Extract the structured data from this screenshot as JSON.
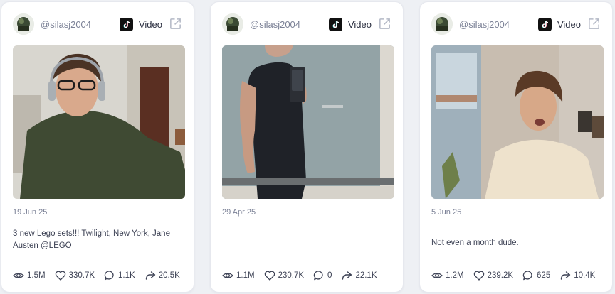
{
  "posts": [
    {
      "username": "@silasj2004",
      "platform": "Video",
      "date": "19 Jun 25",
      "caption": "3 new Lego sets!!! Twilight, New York, Jane Austen @LEGO",
      "stats": {
        "views": "1.5M",
        "likes": "330.7K",
        "comments": "1.1K",
        "shares": "20.5K"
      }
    },
    {
      "username": "@silasj2004",
      "platform": "Video",
      "date": "29 Apr 25",
      "caption": "",
      "stats": {
        "views": "1.1M",
        "likes": "230.7K",
        "comments": "0",
        "shares": "22.1K"
      }
    },
    {
      "username": "@silasj2004",
      "platform": "Video",
      "date": "5 Jun 25",
      "caption": "Not even a month dude.",
      "stats": {
        "views": "1.2M",
        "likes": "239.2K",
        "comments": "625",
        "shares": "10.4K"
      }
    }
  ],
  "icons": {
    "avatar": "avatar-icon",
    "platform": "tiktok-icon",
    "external": "external-link-icon",
    "views": "eye-icon",
    "likes": "heart-icon",
    "comments": "comment-icon",
    "shares": "share-icon"
  },
  "colors": {
    "text_muted": "#7b8196",
    "text": "#3c4154",
    "card": "#ffffff",
    "background": "#eef0f4"
  }
}
